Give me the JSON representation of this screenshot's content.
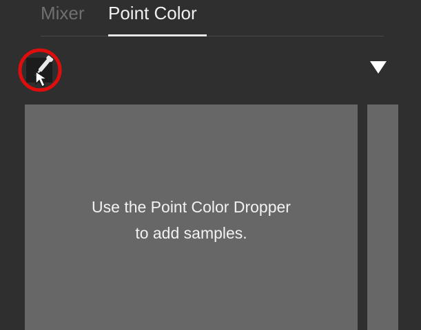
{
  "tabs": {
    "mixer": "Mixer",
    "point_color": "Point Color"
  },
  "active_tab": "Point Color",
  "toolbar": {
    "dropper_icon": "eyedropper-icon",
    "menu_icon": "triangle-down-icon",
    "highlight_color": "#e00d0d"
  },
  "samples": {
    "empty_line1": "Use the Point Color Dropper",
    "empty_line2": "to add samples."
  },
  "colors": {
    "panel_bg": "#2f2f2f",
    "sample_bg": "#676767",
    "active_tab_text": "#f0f0f0",
    "inactive_tab_text": "#707070"
  }
}
